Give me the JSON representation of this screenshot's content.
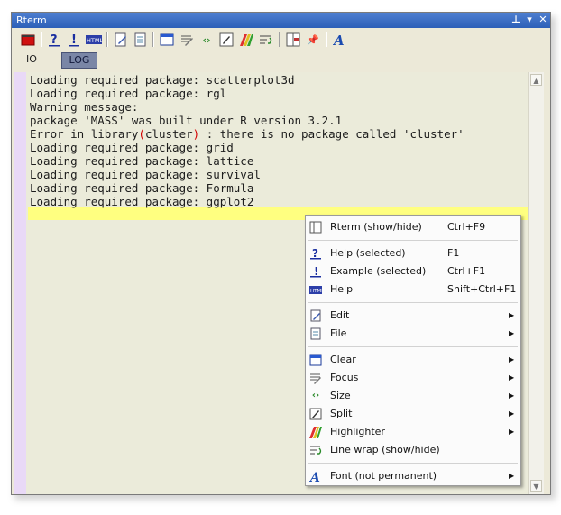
{
  "window": {
    "title": "Rterm"
  },
  "toolbar": {
    "icons": [
      "stop-icon",
      "help-icon",
      "example-icon",
      "html-help-icon",
      "edit-icon",
      "file-icon",
      "clear-icon",
      "focus-icon",
      "size-icon",
      "split-icon",
      "highlighter-icon",
      "linewrap-icon",
      "rterm-icon",
      "pin-icon",
      "font-icon"
    ]
  },
  "tabs": [
    {
      "label": "IO",
      "active": false
    },
    {
      "label": "LOG",
      "active": true
    }
  ],
  "console": {
    "lines": [
      "Loading required package: scatterplot3d",
      "Loading required package: rgl",
      "Warning message:",
      "package 'MASS' was built under R version 3.2.1",
      "Error in library(cluster) : there is no package called 'cluster'",
      "Loading required package: grid",
      "Loading required package: lattice",
      "Loading required package: survival",
      "Loading required package: Formula",
      "Loading required package: ggplot2"
    ]
  },
  "context_menu": {
    "items": [
      {
        "label": "Rterm (show/hide)",
        "shortcut": "Ctrl+F9",
        "icon": "rterm-window-icon",
        "submenu": false
      },
      {
        "label": "Help (selected)",
        "shortcut": "F1",
        "icon": "help-icon",
        "submenu": false
      },
      {
        "label": "Example (selected)",
        "shortcut": "Ctrl+F1",
        "icon": "example-icon",
        "submenu": false
      },
      {
        "label": "Help",
        "shortcut": "Shift+Ctrl+F1",
        "icon": "html-help-icon",
        "submenu": false
      },
      {
        "label": "Edit",
        "shortcut": "",
        "icon": "edit-icon",
        "submenu": true
      },
      {
        "label": "File",
        "shortcut": "",
        "icon": "file-icon",
        "submenu": true
      },
      {
        "label": "Clear",
        "shortcut": "",
        "icon": "clear-icon",
        "submenu": true
      },
      {
        "label": "Focus",
        "shortcut": "",
        "icon": "focus-icon",
        "submenu": true
      },
      {
        "label": "Size",
        "shortcut": "",
        "icon": "size-icon",
        "submenu": true
      },
      {
        "label": "Split",
        "shortcut": "",
        "icon": "split-icon",
        "submenu": true
      },
      {
        "label": "Highlighter",
        "shortcut": "",
        "icon": "highlighter-icon",
        "submenu": true
      },
      {
        "label": "Line wrap (show/hide)",
        "shortcut": "",
        "icon": "linewrap-icon",
        "submenu": false
      },
      {
        "label": "Font (not permanent)",
        "shortcut": "",
        "icon": "font-icon",
        "submenu": true
      }
    ]
  },
  "colors": {
    "editor_bg": "#ebebda",
    "gutter": "#e9d9f7",
    "current_line": "#ffff80",
    "error_paren": "#d40000",
    "title_bar": "#2c5fb8"
  }
}
